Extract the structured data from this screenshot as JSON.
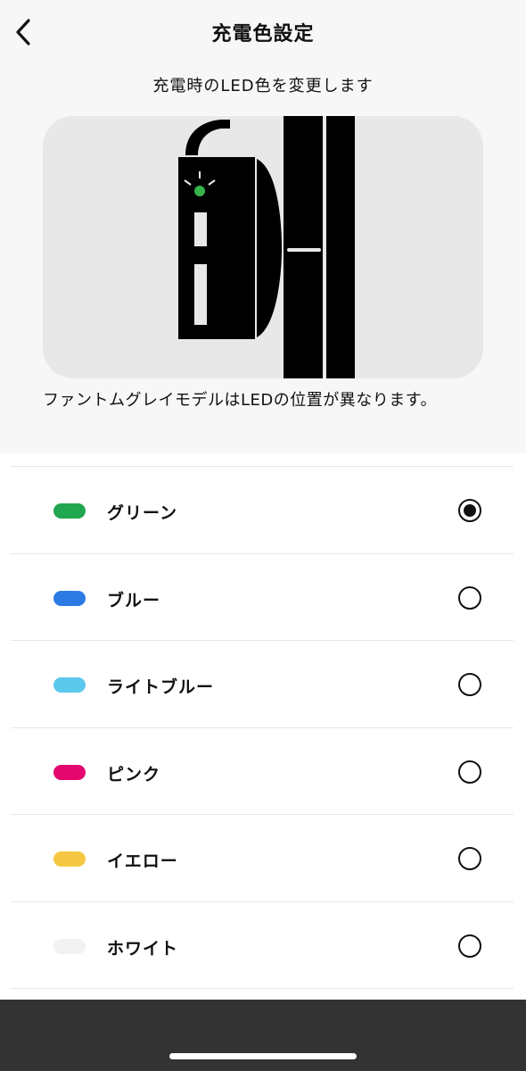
{
  "header": {
    "title": "充電色設定",
    "back_icon": "chevron-left-icon"
  },
  "subtitle": "充電時のLED色を変更します",
  "illustration": {
    "led_color": "#37b34a"
  },
  "note": "ファントムグレイモデルはLEDの位置が異なります。",
  "options": [
    {
      "label": "グリーン",
      "color": "#22a751",
      "selected": true
    },
    {
      "label": "ブルー",
      "color": "#2c7be5",
      "selected": false
    },
    {
      "label": "ライトブルー",
      "color": "#5bc8ec",
      "selected": false
    },
    {
      "label": "ピンク",
      "color": "#e4086e",
      "selected": false
    },
    {
      "label": "イエロー",
      "color": "#f4c842",
      "selected": false
    },
    {
      "label": "ホワイト",
      "color": "#f2f2f2",
      "selected": false
    }
  ]
}
